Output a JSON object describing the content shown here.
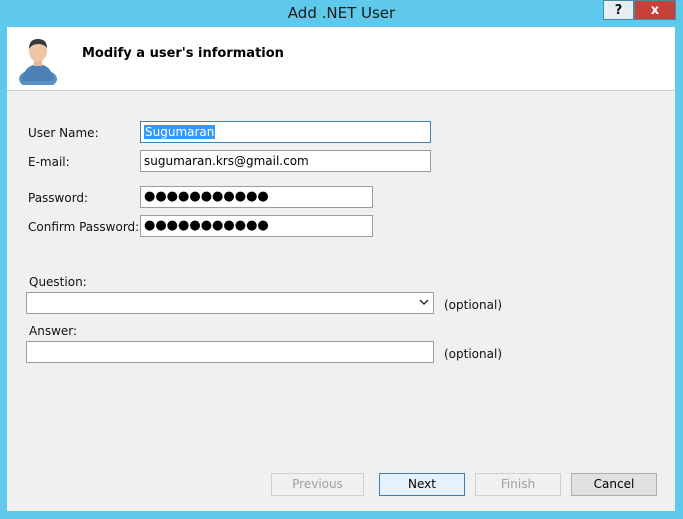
{
  "window": {
    "title": "Add .NET User",
    "help_label": "?",
    "close_label": "x"
  },
  "header": {
    "title": "Modify a user's information",
    "icon": "user-avatar-icon"
  },
  "form": {
    "username_label": "User Name:",
    "username_value": "Sugumaran",
    "email_label": "E-mail:",
    "email_value": "sugumaran.krs@gmail.com",
    "password_label": "Password:",
    "password_value": "●●●●●●●●●●●",
    "confirm_label": "Confirm Password:",
    "confirm_value": "●●●●●●●●●●●",
    "question_label": "Question:",
    "question_value": "",
    "question_optional": "(optional)",
    "answer_label": "Answer:",
    "answer_value": "",
    "answer_optional": "(optional)"
  },
  "buttons": {
    "previous": "Previous",
    "next": "Next",
    "finish": "Finish",
    "cancel": "Cancel"
  },
  "colors": {
    "titlebar": "#5ec9ea",
    "close_button": "#c7413a",
    "selection": "#3399ff"
  }
}
